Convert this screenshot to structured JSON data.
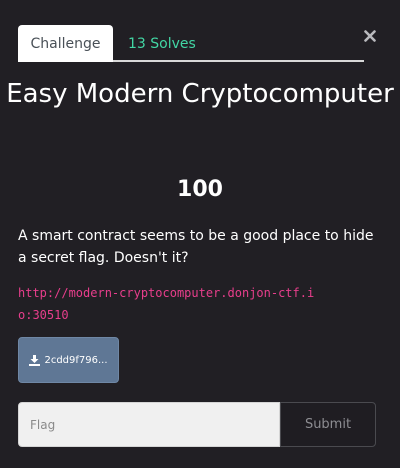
{
  "tabs": {
    "challenge": "Challenge",
    "solves": "13 Solves"
  },
  "challenge": {
    "name": "Easy Modern Cryptocomputer",
    "value": "100",
    "description": "A smart contract seems to be a good place to hide a secret flag. Doesn't it?",
    "url": "http://modern-cryptocomputer.donjon-ctf.io:30510",
    "file_label": "2cdd9f796..."
  },
  "form": {
    "flag_placeholder": "Flag",
    "submit_label": "Submit"
  },
  "icons": {
    "close": "close-icon",
    "download": "download-icon"
  },
  "colors": {
    "accent": "#42d6a4",
    "url": "#e83e8c",
    "file_button": "#5f7795"
  }
}
